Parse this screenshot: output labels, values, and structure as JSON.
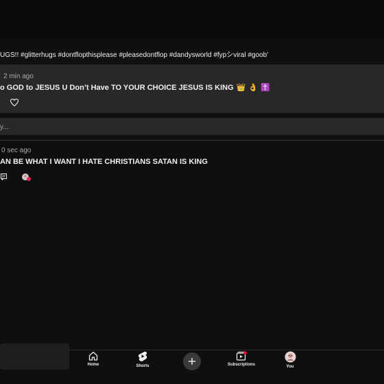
{
  "video": {
    "caption": "UGS!! #glitterhugs #dontflopthisplease #pleasedontflop #dandysworld #fypシviral #goob’"
  },
  "comments": [
    {
      "timestamp": "2 min ago",
      "text": "o GOD to JESUS U Don’t Have TO YOUR CHOICE JESUS IS KING",
      "emojis": [
        "👑",
        "👌",
        "✝️"
      ],
      "like_icon": "heart-outline"
    },
    {
      "timestamp": "0 sec ago",
      "text": "AN BE WHAT I WANT I HATE CHRISTIANS SATAN IS KING",
      "reply_icon": "comment-reply",
      "avatar_icon": "user-avatar"
    }
  ],
  "reply_box": {
    "placeholder": "y..."
  },
  "bottom_nav": {
    "items": [
      {
        "label": "Home",
        "icon": "home"
      },
      {
        "label": "Shorts",
        "icon": "shorts"
      },
      {
        "label": "",
        "icon": "plus"
      },
      {
        "label": "Subscriptions",
        "icon": "subscriptions"
      },
      {
        "label": "You",
        "icon": "avatar"
      }
    ]
  },
  "colors": {
    "background": "#0f0f0f",
    "card": "#282828",
    "text": "#f1f1f1",
    "muted": "#aaaaaa",
    "notification": "#ff0033"
  }
}
